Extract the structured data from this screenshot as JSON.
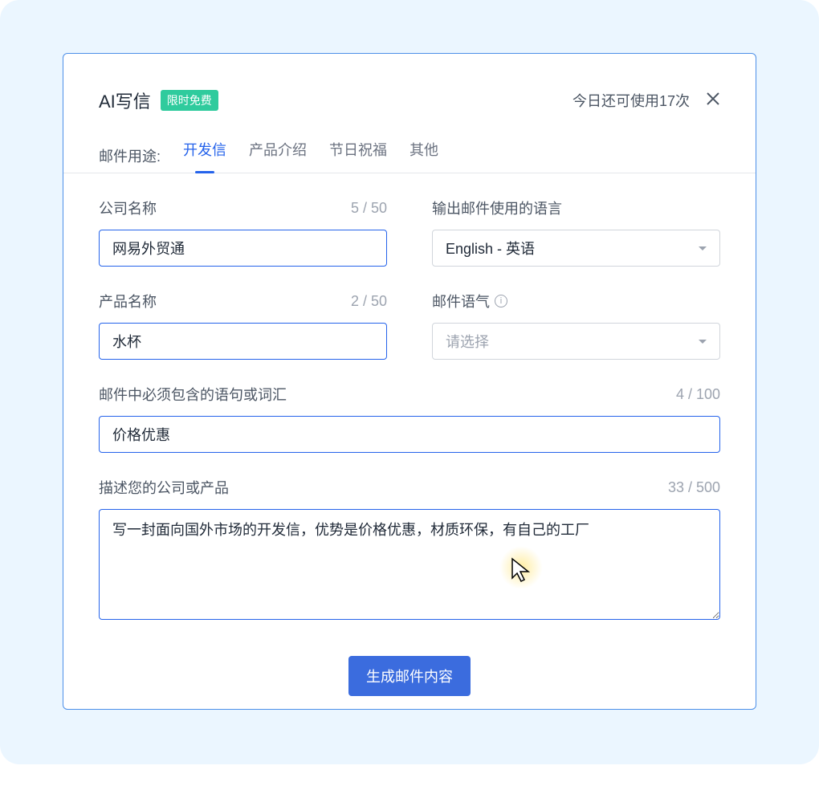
{
  "header": {
    "title": "AI写信",
    "badge": "限时免费",
    "usage_text": "今日还可使用17次"
  },
  "tabs": {
    "label": "邮件用途:",
    "items": [
      "开发信",
      "产品介绍",
      "节日祝福",
      "其他"
    ],
    "active_index": 0
  },
  "fields": {
    "company_name": {
      "label": "公司名称",
      "value": "网易外贸通",
      "count": "5 / 50"
    },
    "output_language": {
      "label": "输出邮件使用的语言",
      "value": "English - 英语"
    },
    "product_name": {
      "label": "产品名称",
      "value": "水杯",
      "count": "2 / 50"
    },
    "tone": {
      "label": "邮件语气",
      "placeholder": "请选择"
    },
    "required_words": {
      "label": "邮件中必须包含的语句或词汇",
      "value": "价格优惠",
      "count": "4 / 100"
    },
    "description": {
      "label": "描述您的公司或产品",
      "value": "写一封面向国外市场的开发信，优势是价格优惠，材质环保，有自己的工厂",
      "count": "33 / 500"
    }
  },
  "submit": {
    "label": "生成邮件内容"
  }
}
